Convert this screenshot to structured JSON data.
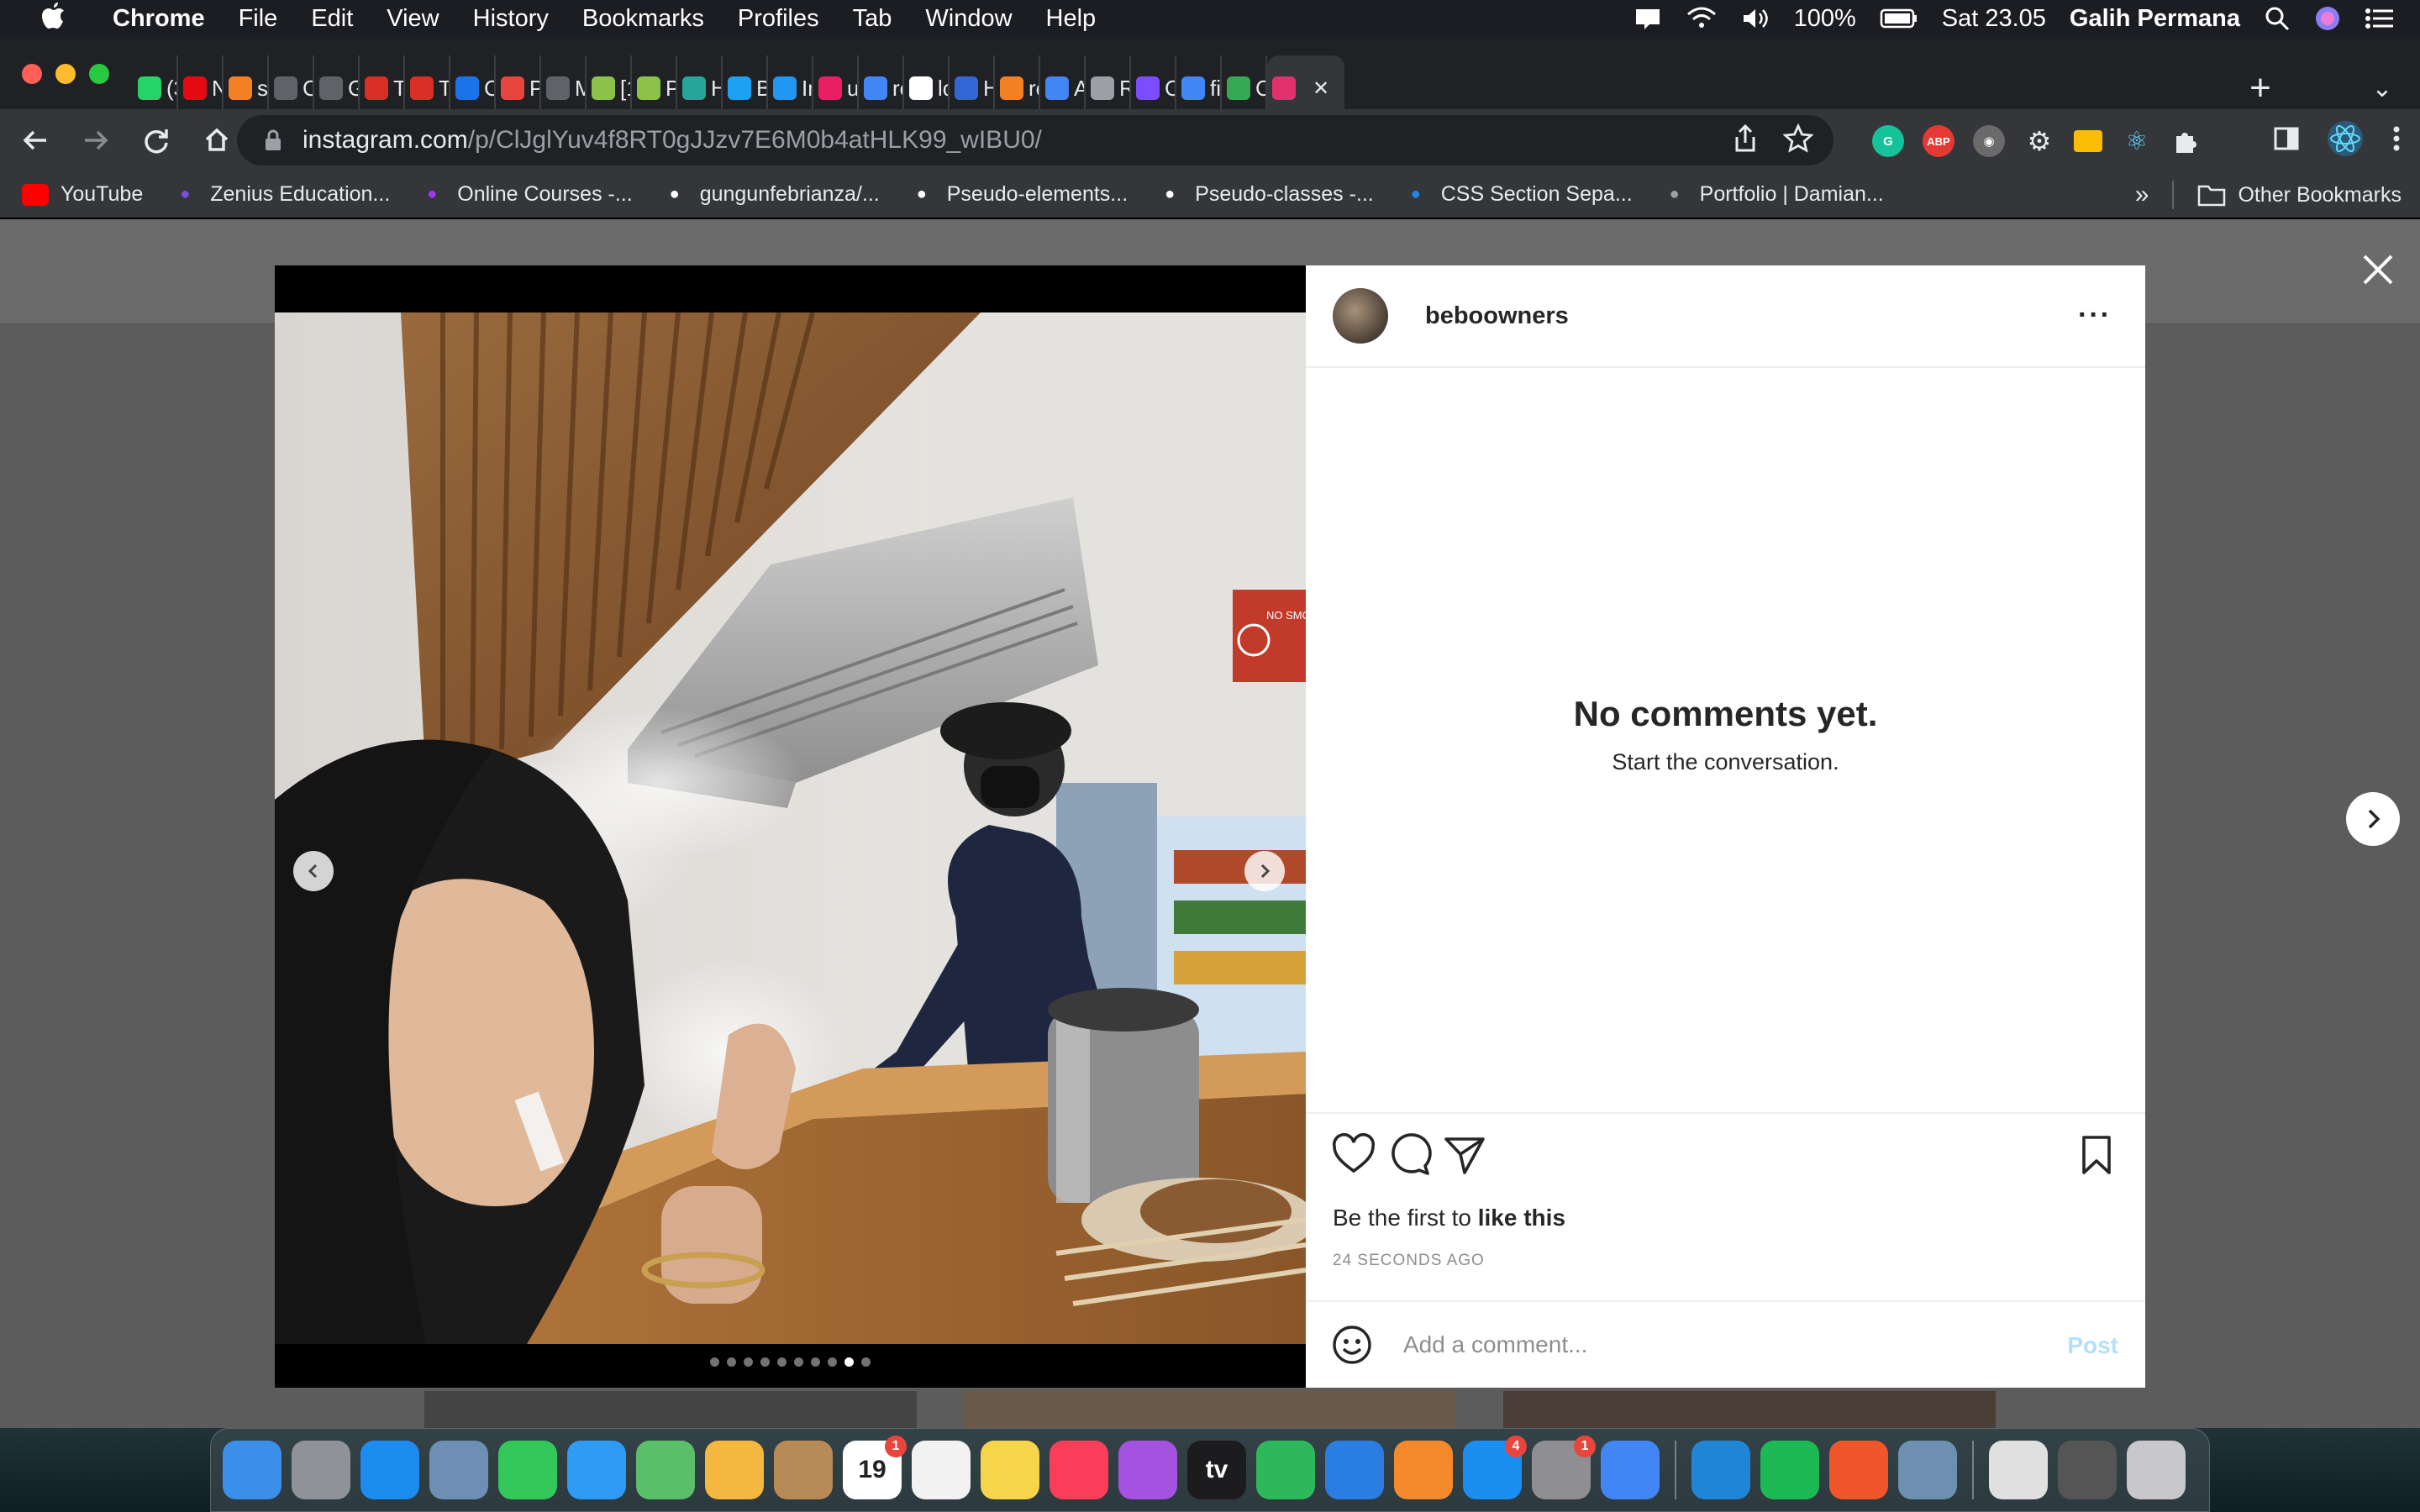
{
  "menubar": {
    "app_name": "Chrome",
    "items": [
      "File",
      "Edit",
      "View",
      "History",
      "Bookmarks",
      "Profiles",
      "Tab",
      "Window",
      "Help"
    ],
    "battery": "100%",
    "clock": "Sat 23.05",
    "user": "Galih Permana"
  },
  "tabs": [
    {
      "label": "(3",
      "icon": "whatsapp-icon",
      "color": "#25d366"
    },
    {
      "label": "N",
      "icon": "netflix-icon",
      "color": "#e50914"
    },
    {
      "label": "s",
      "icon": "stackoverflow-icon",
      "color": "#f48024"
    },
    {
      "label": "C",
      "icon": "globe-icon",
      "color": "#5f6368"
    },
    {
      "label": "G",
      "icon": "globe-icon",
      "color": "#5f6368"
    },
    {
      "label": "T",
      "icon": "tab-icon",
      "color": "#d93025"
    },
    {
      "label": "T",
      "icon": "tab-icon",
      "color": "#d93025"
    },
    {
      "label": "C",
      "icon": "doc-icon",
      "color": "#1a73e8"
    },
    {
      "label": "P",
      "icon": "magnet-icon",
      "color": "#e8453c"
    },
    {
      "label": "M",
      "icon": "globe-icon",
      "color": "#5f6368"
    },
    {
      "label": "[1",
      "icon": "smiley-icon",
      "color": "#8bc34a"
    },
    {
      "label": "P",
      "icon": "smiley-icon",
      "color": "#8bc34a"
    },
    {
      "label": "H",
      "icon": "r-icon",
      "color": "#26a69a"
    },
    {
      "label": "B",
      "icon": "twitter-icon",
      "color": "#1da1f2"
    },
    {
      "label": "In",
      "icon": "wave-icon",
      "color": "#2196f3"
    },
    {
      "label": "u",
      "icon": "dots-icon",
      "color": "#e91e63"
    },
    {
      "label": "re",
      "icon": "google-icon",
      "color": "#4285f4"
    },
    {
      "label": "lo",
      "icon": "github-icon",
      "color": "#ffffff"
    },
    {
      "label": "H",
      "icon": "hex-icon",
      "color": "#3367d6"
    },
    {
      "label": "re",
      "icon": "stackoverflow-icon",
      "color": "#f48024"
    },
    {
      "label": "A",
      "icon": "diamond-icon",
      "color": "#4285f4"
    },
    {
      "label": "R",
      "icon": "image-icon",
      "color": "#9aa0a6"
    },
    {
      "label": "C",
      "icon": "a-icon",
      "color": "#7c4dff"
    },
    {
      "label": "fi",
      "icon": "google-icon",
      "color": "#4285f4"
    },
    {
      "label": "C",
      "icon": "w-icon",
      "color": "#34a853"
    },
    {
      "label": "",
      "icon": "instagram-icon",
      "color": "#e1306c",
      "active": true
    }
  ],
  "omnibox": {
    "host": "instagram.com",
    "path": "/p/ClJglYuv4f8RT0gJJzv7E6M0b4atHLK99_wIBU0/"
  },
  "bookmarks": [
    {
      "label": "YouTube",
      "icon": "youtube-icon",
      "color": "#ff0000"
    },
    {
      "label": "Zenius Education...",
      "icon": "zenius-icon",
      "color": "#7b4ddf"
    },
    {
      "label": "Online Courses -...",
      "icon": "udemy-icon",
      "color": "#a435f0"
    },
    {
      "label": "gungunfebrianza/...",
      "icon": "github-icon",
      "color": "#ffffff"
    },
    {
      "label": "Pseudo-elements...",
      "icon": "mdn-icon",
      "color": "#ffffff"
    },
    {
      "label": "Pseudo-classes -...",
      "icon": "mdn-icon",
      "color": "#ffffff"
    },
    {
      "label": "CSS Section Sepa...",
      "icon": "css-icon",
      "color": "#1e88e5"
    },
    {
      "label": "Portfolio | Damian...",
      "icon": "portfolio-icon",
      "color": "#9aa0a6"
    }
  ],
  "bookmarks_more": "»",
  "other_bookmarks": "Other Bookmarks",
  "post": {
    "username": "beboowners",
    "more": "···",
    "no_comments_title": "No comments yet.",
    "no_comments_sub": "Start the conversation.",
    "likes_prefix": "Be the first to ",
    "likes_link": "like this",
    "timestamp": "24 SECONDS AGO",
    "comment_placeholder": "Add a comment...",
    "post_button": "Post",
    "carousel_total": 10,
    "carousel_current": 9
  },
  "photo_sign": "NO SMOKING",
  "dock": [
    {
      "name": "finder-icon",
      "color": "#3b8fe8"
    },
    {
      "name": "launchpad-icon",
      "color": "#8f9399"
    },
    {
      "name": "safari-icon",
      "color": "#1d8cf0"
    },
    {
      "name": "preview-icon",
      "color": "#6c8fb3"
    },
    {
      "name": "facetime-icon",
      "color": "#34c759"
    },
    {
      "name": "messages-icon",
      "color": "#2f9bf5"
    },
    {
      "name": "maps-icon",
      "color": "#5bbf6a"
    },
    {
      "name": "photos-icon",
      "color": "#f4b740"
    },
    {
      "name": "contacts-icon",
      "color": "#b88a56"
    },
    {
      "name": "calendar-icon",
      "color": "#ffffff",
      "text": "19",
      "badge": "1"
    },
    {
      "name": "reminders-icon",
      "color": "#f2f2f2"
    },
    {
      "name": "notes-icon",
      "color": "#f7d54a"
    },
    {
      "name": "music-icon",
      "color": "#fa3e5a"
    },
    {
      "name": "podcasts-icon",
      "color": "#a452e0"
    },
    {
      "name": "tv-icon",
      "color": "#1c1c1e",
      "text": "tv"
    },
    {
      "name": "numbers-icon",
      "color": "#2eb85c"
    },
    {
      "name": "keynote-icon",
      "color": "#2a7de1"
    },
    {
      "name": "pages-icon",
      "color": "#f58a2c"
    },
    {
      "name": "appstore-icon",
      "color": "#1b8ef2",
      "badge": "4"
    },
    {
      "name": "system-preferences-icon",
      "color": "#8e8e93",
      "badge": "1"
    },
    {
      "name": "chrome-icon",
      "color": "#4285f4"
    },
    {
      "name": "vscode-icon",
      "color": "#1f86d6"
    },
    {
      "name": "spotify-icon",
      "color": "#1db954"
    },
    {
      "name": "brave-icon",
      "color": "#f1562b"
    },
    {
      "name": "image-capture-icon",
      "color": "#6d8fb0"
    },
    {
      "name": "archive-icon",
      "color": "#e0e0e0"
    },
    {
      "name": "screenshot-stack-icon",
      "color": "#555555"
    },
    {
      "name": "trash-icon",
      "color": "#c8c8cc"
    }
  ]
}
